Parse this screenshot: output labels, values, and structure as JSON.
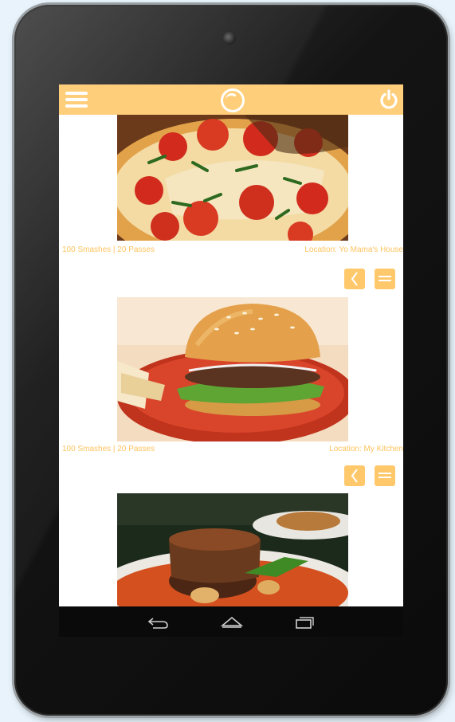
{
  "device": {
    "type": "tablet"
  },
  "topbar": {
    "menu_icon": "hamburger-menu-icon",
    "logo_icon": "app-logo-ring-icon",
    "power_icon": "power-icon",
    "color": "#ffce7a"
  },
  "posts": [
    {
      "image": "pizza-photo",
      "stats": "100 Smashes | 20 Passes",
      "location": "Location: Yo Mama's House"
    },
    {
      "image": "burger-photo",
      "stats": "100 Smashes | 20 Passes",
      "location": "Location: My Kitchen"
    },
    {
      "image": "steak-photo"
    }
  ],
  "actions": {
    "share_icon": "share-chevron-icon",
    "menu_icon": "list-menu-icon"
  },
  "navbar": {
    "back_icon": "back-icon",
    "home_icon": "home-icon",
    "recents_icon": "recents-icon"
  },
  "colors": {
    "accent": "#ffce7a",
    "text_accent": "#ffc35e",
    "navbar": "#0a0a0a"
  }
}
